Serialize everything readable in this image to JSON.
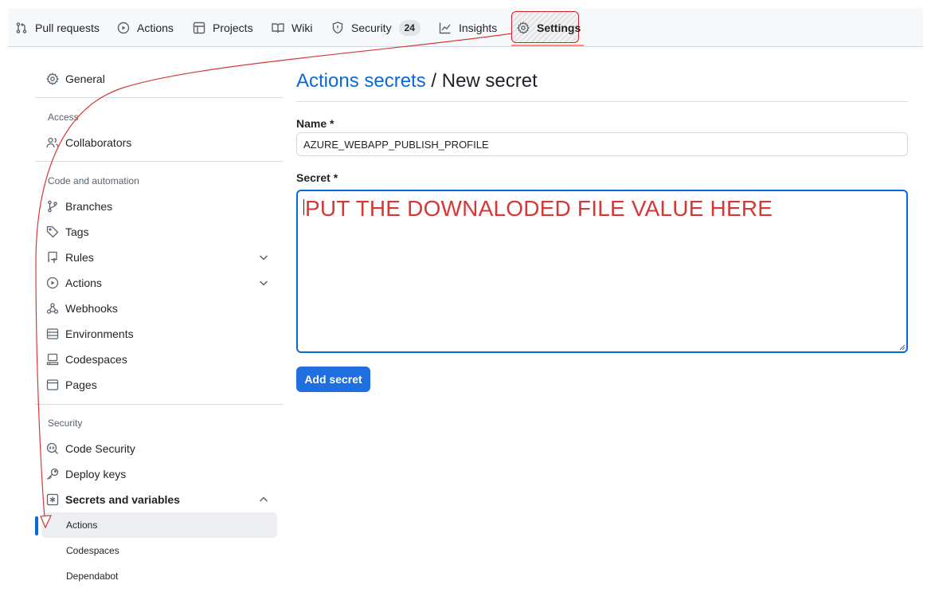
{
  "nav": {
    "pull_requests": "Pull requests",
    "actions": "Actions",
    "projects": "Projects",
    "wiki": "Wiki",
    "security": "Security",
    "security_count": "24",
    "insights": "Insights",
    "settings": "Settings"
  },
  "sidebar": {
    "general": "General",
    "access_heading": "Access",
    "collaborators": "Collaborators",
    "code_heading": "Code and automation",
    "branches": "Branches",
    "tags": "Tags",
    "rules": "Rules",
    "actions": "Actions",
    "webhooks": "Webhooks",
    "environments": "Environments",
    "codespaces": "Codespaces",
    "pages": "Pages",
    "security_heading": "Security",
    "code_security": "Code Security",
    "deploy_keys": "Deploy keys",
    "secrets_and_variables": "Secrets and variables",
    "sub_actions": "Actions",
    "sub_codespaces": "Codespaces",
    "sub_dependabot": "Dependabot"
  },
  "main": {
    "breadcrumb_link": "Actions secrets",
    "breadcrumb_separator": " / ",
    "breadcrumb_current": "New secret",
    "name_label": "Name *",
    "name_value": "AZURE_WEBAPP_PUBLISH_PROFILE",
    "secret_label": "Secret *",
    "secret_annotation": "PUT THE DOWNALODED FILE VALUE HERE",
    "add_button": "Add secret"
  },
  "colors": {
    "accent": "#0969da",
    "annotation_red": "#d63838",
    "button": "#1f6fe0"
  }
}
